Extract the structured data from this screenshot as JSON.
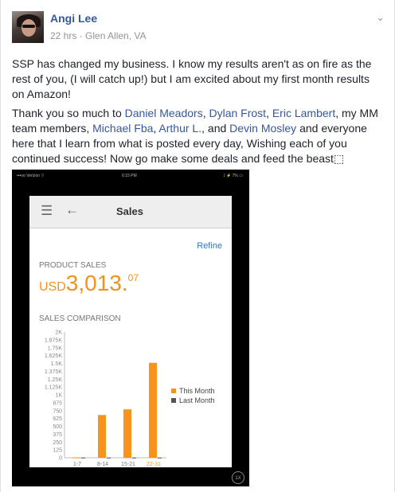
{
  "post": {
    "author": "Angi Lee",
    "time": "22 hrs",
    "separator": " · ",
    "location": "Glen Allen, VA",
    "options_glyph": "⌄",
    "paragraph1": "SSP has changed my business. I know my results aren't as on fire as the rest of you, (I will catch up!) but I am excited about my first month results on Amazon!",
    "p2_start": "Thank you so much to ",
    "tag1": "Daniel Meadors",
    "tag2": "Dylan Frost",
    "tag3": "Eric Lambert",
    "comma": ", ",
    "p2_mid1": ", my MM team members, ",
    "tag4": "Michael Fba",
    "tag5": "Arthur L.",
    "p2_mid2": ", and ",
    "tag6": "Devin Mosley",
    "p2_end": " and everyone here that I learn from what is posted every day, Wishing each of you continued success! Now go make some deals and feed the beast",
    "emoji_glyph": "⬚",
    "colors": {
      "link": "#365899",
      "meta": "#90949c",
      "text": "#1d2129"
    }
  },
  "phone": {
    "carrier": "•••oo Verizon  ⌔",
    "clock": "6:15 PM",
    "battery": "⟟ ⚡ 7% ▭",
    "app_title": "Sales",
    "menu_glyph": "☰",
    "back_glyph": "←",
    "refine": "Refine",
    "product_sales_label": "PRODUCT SALES",
    "currency": "USD",
    "amount_main": "3,013.",
    "amount_cents": "07",
    "comparison_label": "SALES COMPARISON",
    "zoom_badge": "1X",
    "colors": {
      "accent": "#f0931e",
      "link": "#2a78c8",
      "last_month": "#555555"
    }
  },
  "chart_data": {
    "type": "bar",
    "categories": [
      "1-7",
      "8-14",
      "15-21",
      "22-31"
    ],
    "series": [
      {
        "name": "This Month",
        "color": "#f7941d",
        "values": [
          5,
          680,
          770,
          1510
        ]
      },
      {
        "name": "Last Month",
        "color": "#555555",
        "values": [
          3,
          3,
          3,
          3
        ]
      }
    ],
    "ylim": [
      0,
      2000
    ],
    "yticks": [
      "0",
      "125",
      "250",
      "375",
      "500",
      "625",
      "750",
      "875",
      "1K",
      "1.125K",
      "1.25K",
      "1.375K",
      "1.5K",
      "1.625K",
      "1.75K",
      "1.875K",
      "2K"
    ],
    "highlighted_category": "22-31",
    "grid": false,
    "legend": "right"
  }
}
